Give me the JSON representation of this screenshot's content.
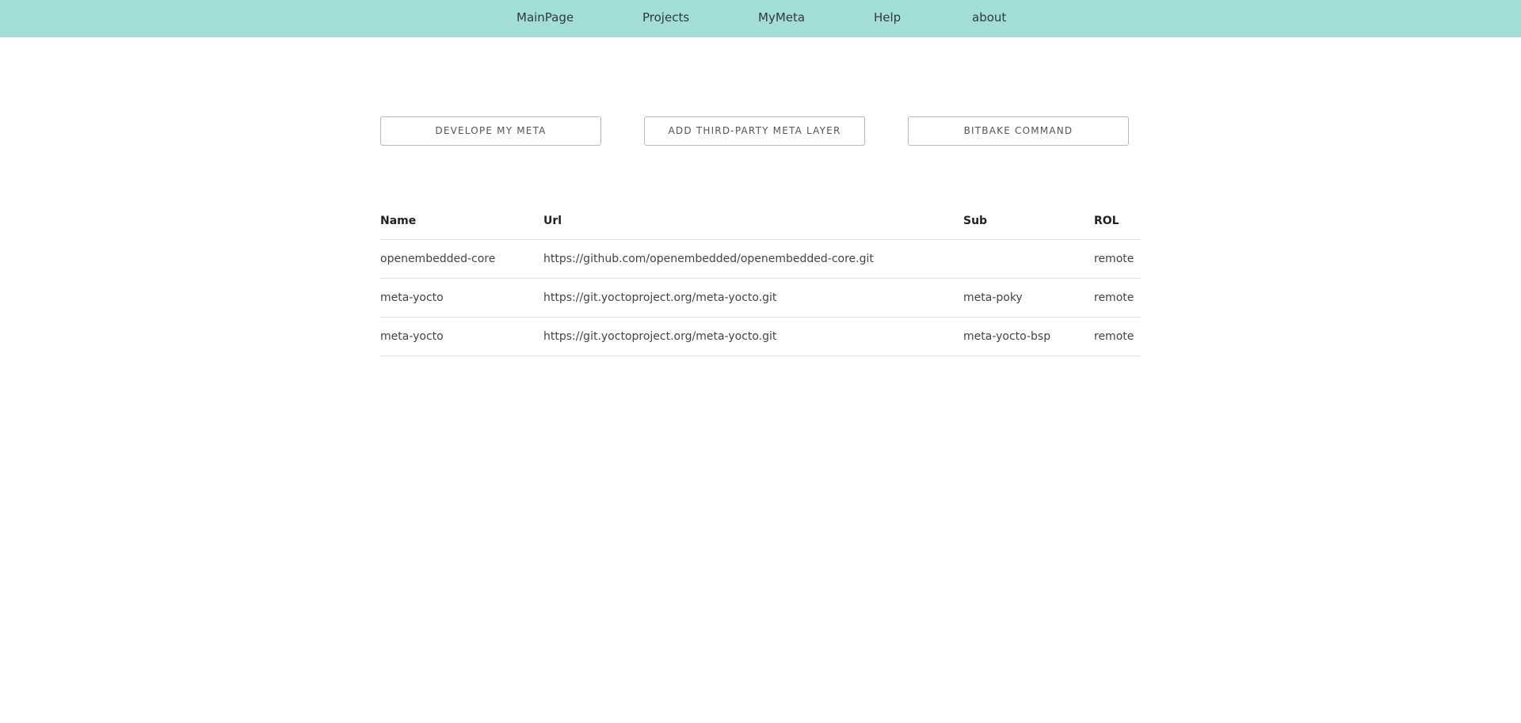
{
  "navbar": {
    "items": [
      {
        "label": "MainPage"
      },
      {
        "label": "Projects"
      },
      {
        "label": "MyMeta"
      },
      {
        "label": "Help"
      },
      {
        "label": "about"
      }
    ]
  },
  "actions": {
    "develope_label": "DEVELOPE MY META",
    "add_layer_label": "ADD THIRD-PARTY META LAYER",
    "bitbake_label": "BITBAKE COMMAND"
  },
  "table": {
    "columns": [
      "Name",
      "Url",
      "Sub",
      "ROL"
    ],
    "rows": [
      {
        "name": "openembedded-core",
        "url": "https://github.com/openembedded/openembedded-core.git",
        "sub": "",
        "rol": "remote"
      },
      {
        "name": "meta-yocto",
        "url": "https://git.yoctoproject.org/meta-yocto.git",
        "sub": "meta-poky",
        "rol": "remote"
      },
      {
        "name": "meta-yocto",
        "url": "https://git.yoctoproject.org/meta-yocto.git",
        "sub": "meta-yocto-bsp",
        "rol": "remote"
      }
    ]
  },
  "colors": {
    "navbar_bg": "#a2ded7",
    "button_border": "#b9b9b9",
    "row_divider": "#e1e1e1"
  }
}
